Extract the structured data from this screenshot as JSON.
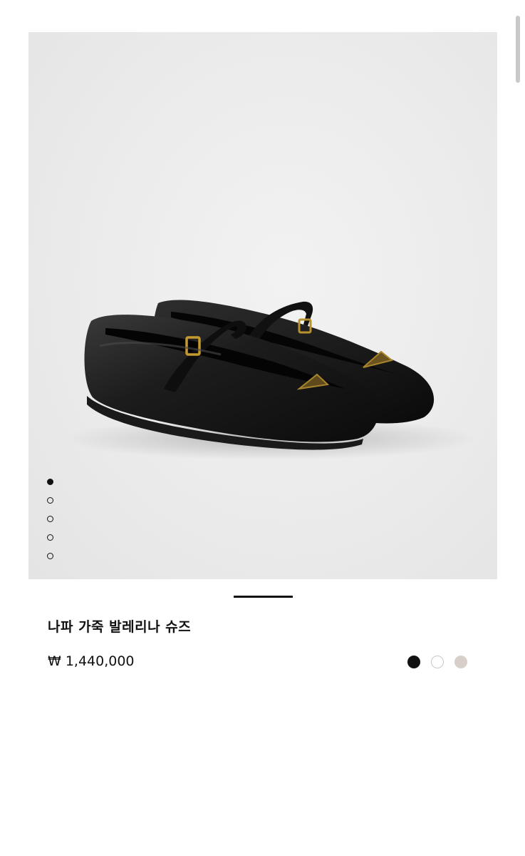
{
  "product": {
    "title": "나파 가죽 발레리나 슈즈",
    "price": "₩ 1,440,000"
  },
  "gallery": {
    "image_alt": "black leather mary jane ballerina flats",
    "slide_count": 5,
    "active_slide": 1
  },
  "colors": [
    {
      "name": "black",
      "hex": "#111111"
    },
    {
      "name": "white",
      "hex": "#ffffff"
    },
    {
      "name": "beige",
      "hex": "#d8d0c8"
    }
  ],
  "theme": {
    "image_bg": "#ebebeb",
    "text": "#111111"
  }
}
